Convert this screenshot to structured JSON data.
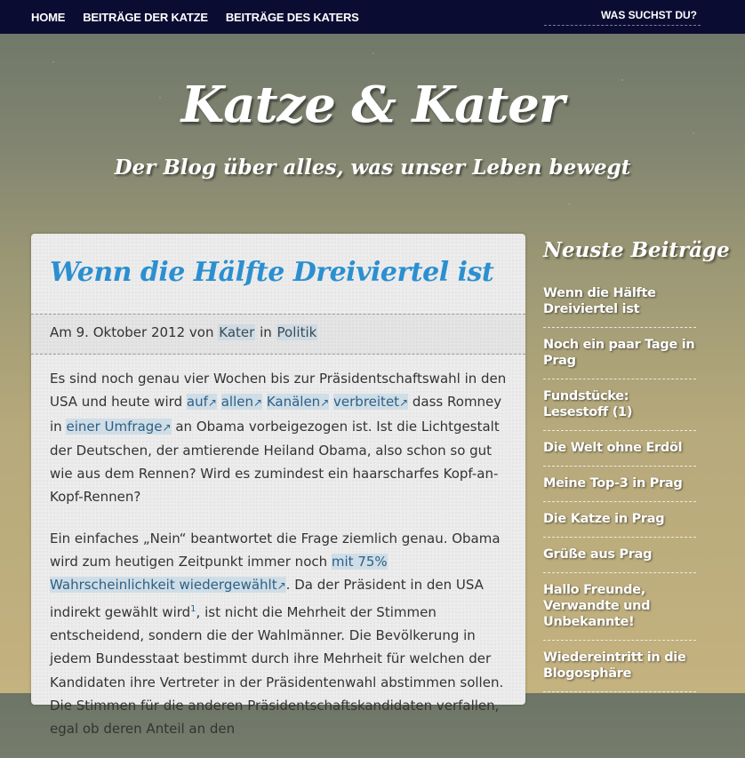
{
  "nav": {
    "items": [
      "HOME",
      "BEITRÄGE DER KATZE",
      "BEITRÄGE DES KATERS"
    ],
    "search_label": "WAS SUCHST DU?"
  },
  "header": {
    "title": "Katze & Kater",
    "subtitle": "Der Blog über alles, was unser Leben bewegt"
  },
  "post": {
    "title": "Wenn die Hälfte Dreiviertel ist",
    "meta": {
      "prefix": "Am 9. Oktober 2012 von",
      "author": "Kater",
      "in": "in",
      "category": "Politik"
    },
    "p1": {
      "a": "Es sind noch genau vier Wochen bis zur Präsidentschaftswahl in den USA und heute wird",
      "l1": "auf",
      "l2": "allen",
      "l3": "Kanälen",
      "l4": "verbreitet",
      "b": "dass Romney in",
      "l5": "einer Umfrage",
      "c": "an Obama vorbeigezogen ist. Ist die Lichtgestalt der Deutschen, der amtierende Heiland Obama, also schon so gut wie aus dem Rennen? Wird es zumindest ein haarscharfes Kopf-an-Kopf-Rennen?"
    },
    "p2": {
      "a": "Ein einfaches „Nein“ beantwortet die Frage ziemlich genau. Obama wird zum heutigen Zeitpunkt immer noch",
      "l1": "mit 75% Wahrscheinlichkeit wiedergewählt",
      "b": ". Da der Präsident in den USA indirekt gewählt wird",
      "fn": "1",
      "c": ", ist nicht die Mehrheit der Stimmen entscheidend,  sondern die der Wahlmänner. Die Bevölkerung in jedem Bundesstaat bestimmt durch ihre Mehrheit für welchen der Kandidaten ihre Vertreter in der Präsidentenwahl abstimmen sollen. Die Stimmen für die anderen Präsidentschaftskandidaten verfallen, egal ob deren Anteil an den"
    },
    "ext_icon": "↗"
  },
  "sidebar": {
    "title": "Neuste Beiträge",
    "items": [
      "Wenn die Hälfte Dreiviertel ist",
      "Noch ein paar Tage in Prag",
      "Fundstücke: Lesestoff (1)",
      "Die Welt ohne Erdöl",
      "Meine Top-3 in Prag",
      "Die Katze in Prag",
      "Grüße aus Prag",
      "Hallo Freunde, Verwandte und Unbekannte!",
      "Wiedereintritt in die Blogosphäre"
    ]
  }
}
